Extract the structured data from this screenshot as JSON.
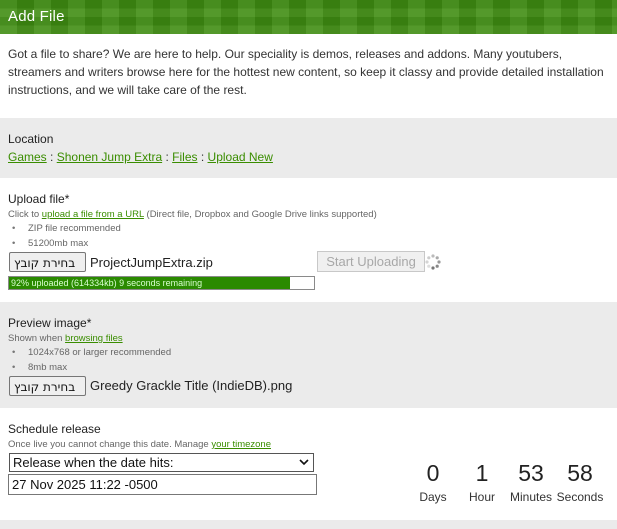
{
  "header": {
    "title": "Add File"
  },
  "intro": "Got a file to share? We are here to help. Our speciality is demos, releases and addons. Many youtubers, streamers and writers browse here for the hottest new content, so keep it classy and provide detailed installation instructions, and we will take care of the rest.",
  "location": {
    "title": "Location",
    "crumbs": [
      "Games",
      "Shonen Jump Extra",
      "Files",
      "Upload New"
    ],
    "separator": ":"
  },
  "upload": {
    "title": "Upload file*",
    "hint_prefix": "Click to",
    "hint_link": "upload a file from a URL",
    "hint_suffix": "(Direct file, Dropbox and Google Drive links supported)",
    "bullets": [
      "ZIP file recommended",
      "51200mb max"
    ],
    "choose_label": "בחירת קובץ",
    "filename": "ProjectJumpExtra.zip",
    "start_label": "Start Uploading",
    "progress_percent": 92,
    "progress_text": "92% uploaded (614334kb) 9 seconds remaining"
  },
  "preview": {
    "title": "Preview image*",
    "hint_prefix": "Shown when",
    "hint_link": "browsing files",
    "bullets": [
      "1024x768 or larger recommended",
      "8mb max"
    ],
    "choose_label": "בחירת קובץ",
    "filename": "Greedy Grackle Title (IndieDB).png"
  },
  "schedule": {
    "title": "Schedule release",
    "hint_prefix": "Once live you cannot change this date. Manage",
    "hint_link": "your timezone",
    "select_value": "Release when the date hits:",
    "date_value": "27 Nov 2025 11:22 -0500",
    "countdown": [
      {
        "value": "0",
        "label": "Days"
      },
      {
        "value": "1",
        "label": "Hour"
      },
      {
        "value": "53",
        "label": "Minutes"
      },
      {
        "value": "58",
        "label": "Seconds"
      }
    ]
  },
  "colors": {
    "header_bg": "#3f8d12",
    "link": "#3a8d00",
    "progress_fill": "#2a8a00",
    "section_grey": "#ebebeb"
  }
}
